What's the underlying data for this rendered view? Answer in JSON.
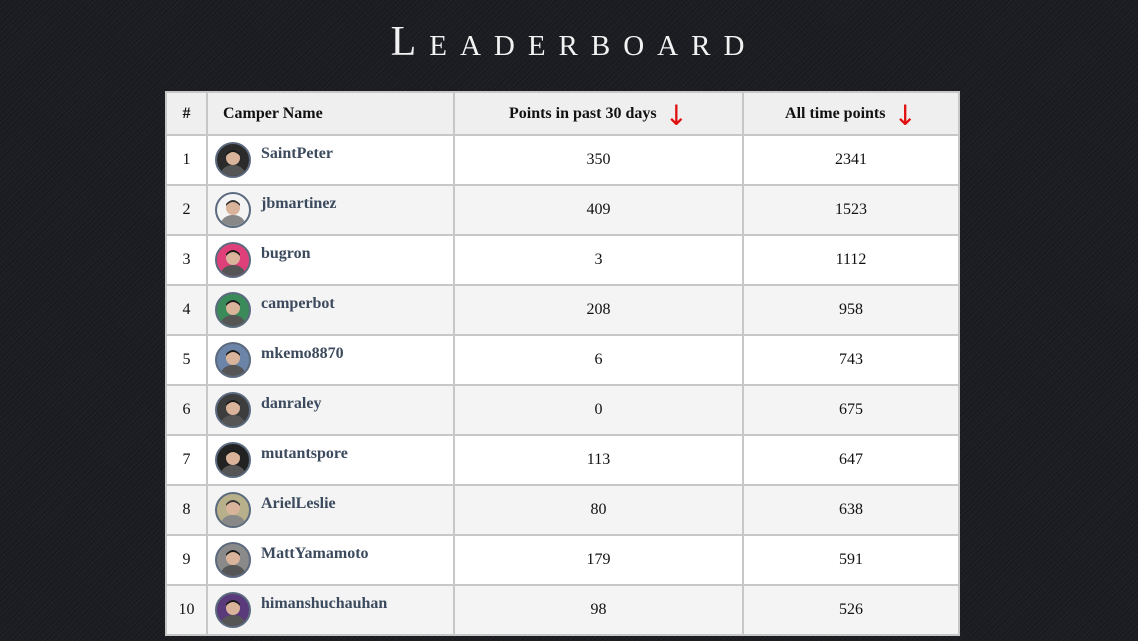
{
  "page": {
    "title": "Leaderboard"
  },
  "table": {
    "headers": {
      "rank": "#",
      "name": "Camper Name",
      "recent": "Points in past 30 days",
      "alltime": "All time points",
      "sort_arrow": "↓"
    },
    "rows": [
      {
        "rank": "1",
        "name": "SaintPeter",
        "recent": "350",
        "alltime": "2341",
        "avatar": "photo-avatar-icon"
      },
      {
        "rank": "2",
        "name": "jbmartinez",
        "recent": "409",
        "alltime": "1523",
        "avatar": "sketch-avatar-icon"
      },
      {
        "rank": "3",
        "name": "bugron",
        "recent": "3",
        "alltime": "1112",
        "avatar": "photo-avatar-icon"
      },
      {
        "rank": "4",
        "name": "camperbot",
        "recent": "208",
        "alltime": "958",
        "avatar": "bot-avatar-icon"
      },
      {
        "rank": "5",
        "name": "mkemo8870",
        "recent": "6",
        "alltime": "743",
        "avatar": "photo-avatar-icon"
      },
      {
        "rank": "6",
        "name": "danraley",
        "recent": "0",
        "alltime": "675",
        "avatar": "photo-avatar-icon"
      },
      {
        "rank": "7",
        "name": "mutantspore",
        "recent": "113",
        "alltime": "647",
        "avatar": "photo-avatar-icon"
      },
      {
        "rank": "8",
        "name": "ArielLeslie",
        "recent": "80",
        "alltime": "638",
        "avatar": "photo-avatar-icon"
      },
      {
        "rank": "9",
        "name": "MattYamamoto",
        "recent": "179",
        "alltime": "591",
        "avatar": "photo-avatar-icon"
      },
      {
        "rank": "10",
        "name": "himanshuchauhan",
        "recent": "98",
        "alltime": "526",
        "avatar": "photo-avatar-icon"
      }
    ]
  },
  "colors": {
    "sort_arrow": "#e01010",
    "link": "#3c4a5e",
    "avatar_border": "#5b6a7e",
    "avatar_fills": [
      "#2b2b2b",
      "#f4f4f4",
      "#e0407a",
      "#3a8a5a",
      "#6b84a8",
      "#3d3d3d",
      "#222222",
      "#b8b08a",
      "#8a8a8a",
      "#5a3a7a"
    ]
  }
}
